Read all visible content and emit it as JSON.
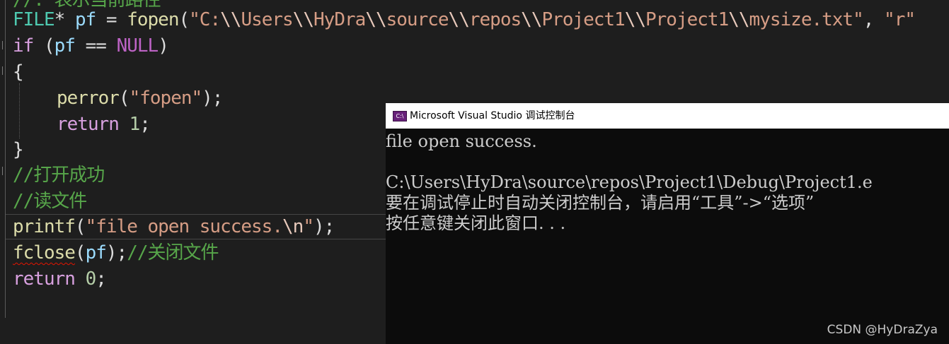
{
  "editor": {
    "lines": [
      {
        "parts": [
          {
            "c": "comment",
            "t": "//. 表示当前路径"
          }
        ]
      },
      {
        "parts": [
          {
            "c": "type",
            "t": "FILE"
          },
          {
            "c": "plain",
            "t": "* "
          },
          {
            "c": "var",
            "t": "pf"
          },
          {
            "c": "plain",
            "t": " = "
          },
          {
            "c": "fn",
            "t": "fopen"
          },
          {
            "c": "plain",
            "t": "("
          },
          {
            "c": "str",
            "t": "\"C:"
          },
          {
            "c": "esc",
            "t": "\\\\"
          },
          {
            "c": "str",
            "t": "Users"
          },
          {
            "c": "esc",
            "t": "\\\\"
          },
          {
            "c": "str",
            "t": "HyDra"
          },
          {
            "c": "esc",
            "t": "\\\\"
          },
          {
            "c": "str",
            "t": "source"
          },
          {
            "c": "esc",
            "t": "\\\\"
          },
          {
            "c": "str",
            "t": "repos"
          },
          {
            "c": "esc",
            "t": "\\\\"
          },
          {
            "c": "str",
            "t": "Project1"
          },
          {
            "c": "esc",
            "t": "\\\\"
          },
          {
            "c": "str",
            "t": "Project1"
          },
          {
            "c": "esc",
            "t": "\\\\"
          },
          {
            "c": "str",
            "t": "mysize.txt\""
          },
          {
            "c": "plain",
            "t": ", "
          },
          {
            "c": "str",
            "t": "\"r\""
          }
        ]
      },
      {
        "parts": [
          {
            "c": "kw2",
            "t": "if"
          },
          {
            "c": "plain",
            "t": " ("
          },
          {
            "c": "var",
            "t": "pf"
          },
          {
            "c": "plain",
            "t": " == "
          },
          {
            "c": "macro",
            "t": "NULL"
          },
          {
            "c": "plain",
            "t": ")"
          }
        ]
      },
      {
        "parts": [
          {
            "c": "plain",
            "t": "{"
          }
        ]
      },
      {
        "indent": true,
        "parts": [
          {
            "c": "fn",
            "t": "perror"
          },
          {
            "c": "plain",
            "t": "("
          },
          {
            "c": "str",
            "t": "\"fopen\""
          },
          {
            "c": "plain",
            "t": ");"
          }
        ]
      },
      {
        "indent": true,
        "parts": [
          {
            "c": "kw2",
            "t": "return"
          },
          {
            "c": "plain",
            "t": " "
          },
          {
            "c": "num",
            "t": "1"
          },
          {
            "c": "plain",
            "t": ";"
          }
        ]
      },
      {
        "parts": [
          {
            "c": "plain",
            "t": "}"
          }
        ]
      },
      {
        "parts": [
          {
            "c": "comment",
            "t": "//打开成功"
          }
        ]
      },
      {
        "parts": [
          {
            "c": "comment",
            "t": "//读文件"
          }
        ]
      },
      {
        "parts": [
          {
            "c": "fn",
            "t": "printf"
          },
          {
            "c": "plain",
            "t": "("
          },
          {
            "c": "str",
            "t": "\"file open success."
          },
          {
            "c": "esc",
            "t": "\\n"
          },
          {
            "c": "str",
            "t": "\""
          },
          {
            "c": "plain",
            "t": ");"
          }
        ]
      },
      {
        "parts": [
          {
            "c": "fn squiggle",
            "t": "fclose"
          },
          {
            "c": "plain",
            "t": "("
          },
          {
            "c": "var",
            "t": "pf"
          },
          {
            "c": "plain",
            "t": ");"
          },
          {
            "c": "comment",
            "t": "//关闭文件"
          }
        ]
      },
      {
        "parts": [
          {
            "c": "kw2",
            "t": "return"
          },
          {
            "c": "plain",
            "t": " "
          },
          {
            "c": "num",
            "t": "0"
          },
          {
            "c": "plain",
            "t": ";"
          }
        ]
      }
    ]
  },
  "console": {
    "title": "Microsoft Visual Studio 调试控制台",
    "icon": "vs-console-icon",
    "lines": [
      "file open success.",
      "",
      "C:\\Users\\HyDra\\source\\repos\\Project1\\Debug\\Project1.e",
      "要在调试停止时自动关闭控制台，请启用“工具”->“选项”",
      "按任意键关闭此窗口. . ."
    ]
  },
  "watermark": "CSDN @HyDraZya",
  "colors": {
    "editor_bg": "#1e1e1e",
    "console_bg": "#0c0c0c",
    "comment": "#57a64a",
    "string": "#d69d85",
    "function": "#dcdcaa",
    "keyword": "#d8a0df",
    "variable": "#9cdcfe",
    "type": "#4ec9b0"
  }
}
